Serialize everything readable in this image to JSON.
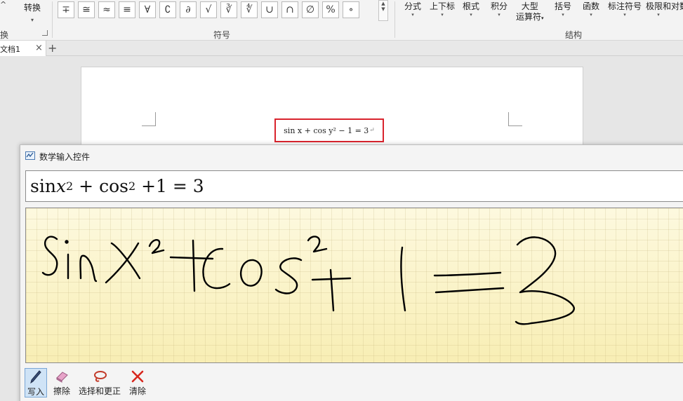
{
  "ribbon": {
    "convert_label": "转换",
    "convert_group_fragment": "换",
    "convert_top_fragment": "^",
    "symbols": [
      "∓",
      "≅",
      "≈",
      "≡",
      "∀",
      "∁",
      "∂",
      "√",
      "∛",
      "∜",
      "∪",
      "∩",
      "∅",
      "%",
      "∘"
    ],
    "symbols_group_label": "符号",
    "structures": [
      {
        "label": "分式"
      },
      {
        "label": "上下标"
      },
      {
        "label": "根式"
      },
      {
        "label": "积分"
      },
      {
        "label": "大型",
        "label2": "运算符"
      },
      {
        "label": "括号"
      },
      {
        "label": "函数"
      },
      {
        "label": "标注符号"
      },
      {
        "label": "极限和对数"
      }
    ],
    "structures_group_label": "结构"
  },
  "tabs": {
    "doc_tab_label": "文档1",
    "close": "×",
    "new": "+"
  },
  "document": {
    "equation": "sin x + cos y² − 1 = 3",
    "paragraph_mark": "↵"
  },
  "dialog": {
    "title": "数学输入控件",
    "preview": {
      "sin": "sin ",
      "x": "x",
      "exp1": "2",
      "plus_cos": " + cos",
      "exp2": "2",
      "rest": " +1 = 3"
    },
    "tools": [
      {
        "name": "write",
        "label": "写入",
        "icon": "pen-icon",
        "active": true
      },
      {
        "name": "erase",
        "label": "擦除",
        "icon": "eraser-icon",
        "active": false
      },
      {
        "name": "select-correct",
        "label": "选择和更正",
        "icon": "lasso-icon",
        "active": false
      },
      {
        "name": "clear",
        "label": "清除",
        "icon": "clear-x-icon",
        "active": false
      }
    ]
  },
  "colors": {
    "highlight_red": "#d9232d",
    "active_tool_blue": "#cfe3f6",
    "ink": "#000000",
    "canvas_yellow": "#fbf3c3"
  }
}
